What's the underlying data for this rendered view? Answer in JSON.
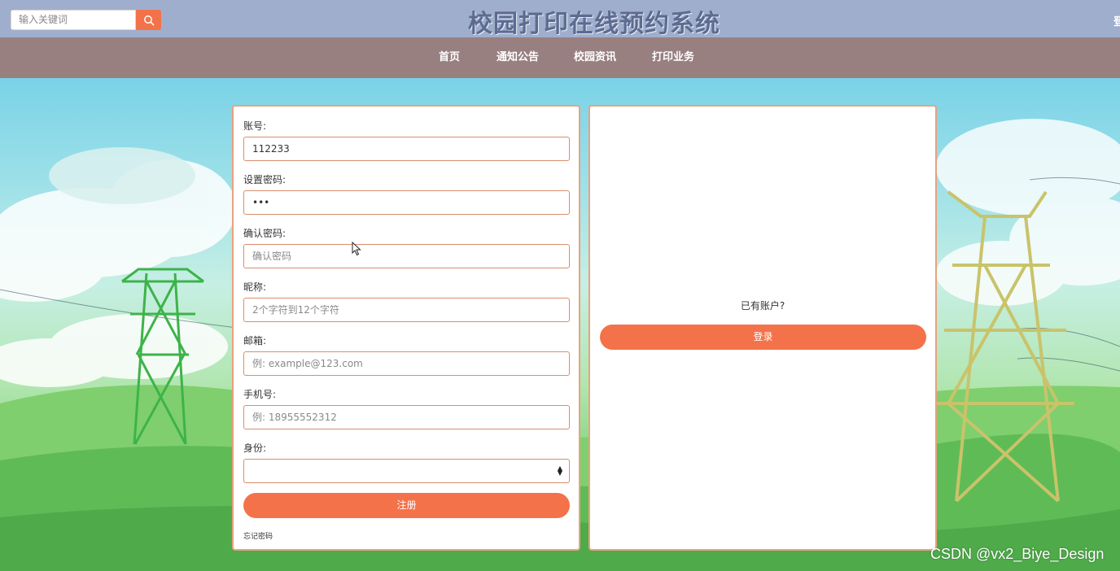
{
  "header": {
    "search_placeholder": "输入关键词",
    "title": "校园打印在线预约系统",
    "login_cut": "登"
  },
  "nav": {
    "items": [
      "首页",
      "通知公告",
      "校园资讯",
      "打印业务"
    ]
  },
  "register_form": {
    "account_label": "账号:",
    "account_value": "112233",
    "password_label": "设置密码:",
    "password_value": "•••",
    "confirm_label": "确认密码:",
    "confirm_placeholder": "确认密码",
    "nickname_label": "昵称:",
    "nickname_placeholder": "2个字符到12个字符",
    "email_label": "邮箱:",
    "email_placeholder": "例: example@123.com",
    "phone_label": "手机号:",
    "phone_placeholder": "例: 18955552312",
    "role_label": "身份:",
    "role_value": "",
    "submit_label": "注册",
    "forgot_label": "忘记密码"
  },
  "login_panel": {
    "question": "已有账户?",
    "login_label": "登录"
  },
  "watermark": "CSDN @vx2_Biye_Design",
  "colors": {
    "accent": "#f47249",
    "header_bg": "#a0aecd",
    "nav_bg": "#987f80",
    "panel_border": "#e9a27e"
  }
}
